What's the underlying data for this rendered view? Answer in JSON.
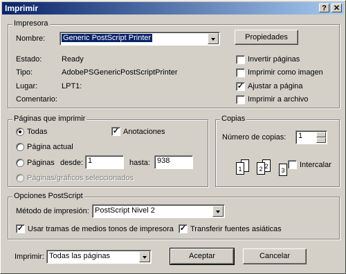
{
  "window": {
    "title": "Imprimir",
    "help_btn": "?",
    "close_btn": "✕"
  },
  "printer": {
    "group_label": "Impresora",
    "name_label": "Nombre:",
    "name_value": "Generic PostScript Printer",
    "properties_button": "Propiedades",
    "status_label": "Estado:",
    "status_value": "Ready",
    "type_label": "Tipo:",
    "type_value": "AdobePSGenericPostScriptPrinter",
    "location_label": "Lugar:",
    "location_value": "LPT1:",
    "comment_label": "Comentario:",
    "opt_invert": "Invertir páginas",
    "opt_print_as_image": "Imprimir como imagen",
    "opt_fit_page": "Ajustar a página",
    "opt_print_to_file": "Imprimir a archivo",
    "opt_invert_checked": false,
    "opt_print_as_image_checked": false,
    "opt_fit_page_checked": true,
    "opt_print_to_file_checked": false
  },
  "range": {
    "group_label": "Páginas que imprimir",
    "all": "Todas",
    "current": "Página actual",
    "pages": "Páginas",
    "from_label": "desde:",
    "from_value": "1",
    "to_label": "hasta:",
    "to_value": "938",
    "selected": "Páginas/gráficos seleccionados",
    "annotations": "Anotaciones",
    "annotations_checked": true,
    "selected_option": "all"
  },
  "copies": {
    "group_label": "Copias",
    "count_label": "Número de copias:",
    "count_value": "1",
    "collate_label": "Intercalar",
    "collate_checked": false,
    "page_numbers": [
      "1",
      "1",
      "2",
      "2",
      "3"
    ]
  },
  "postscript": {
    "group_label": "Opciones PostScript",
    "method_label": "Método de impresión:",
    "method_value": "PostScript Nivel 2",
    "halftone_label": "Usar tramas de medios tonos de impresora",
    "halftone_checked": true,
    "asian_fonts_label": "Transferir fuentes asiáticas",
    "asian_fonts_checked": true
  },
  "footer": {
    "print_label": "Imprimir:",
    "print_value": "Todas las páginas",
    "ok_button": "Aceptar",
    "cancel_button": "Cancelar"
  },
  "colors": {
    "title_start": "#0a246a",
    "title_end": "#a6caf0",
    "face": "#d4d0c8"
  }
}
